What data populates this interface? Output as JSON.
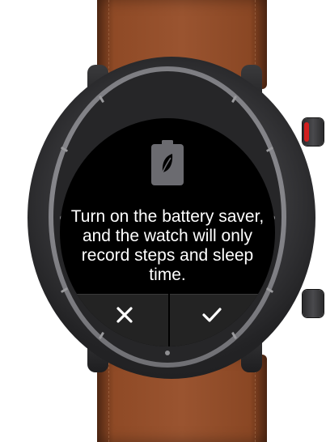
{
  "dialog": {
    "message_lines": [
      "Turn on the battery saver,",
      "and the watch will only",
      "record steps and sleep",
      "time."
    ],
    "icon": "battery-saver-icon",
    "cancel_icon": "close-icon",
    "confirm_icon": "check-icon"
  },
  "colors": {
    "screen_background": "#000000",
    "text": "#ffffff",
    "button_bar": "#232323",
    "icon_fill": "#6b6b70",
    "strap": "#9a5430",
    "crown_accent": "#d21f1f"
  }
}
